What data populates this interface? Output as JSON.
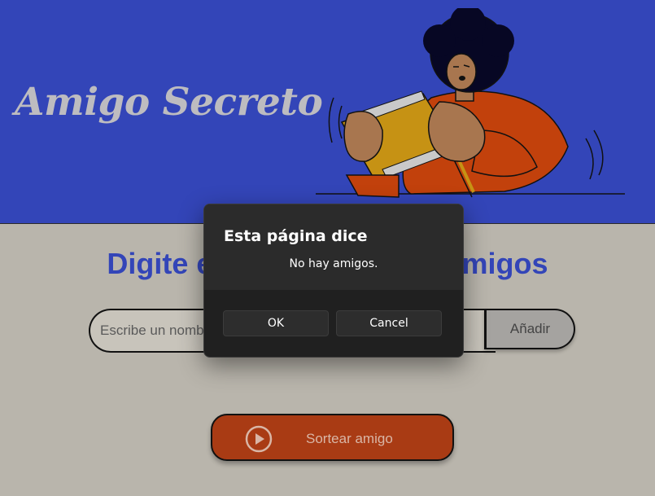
{
  "header": {
    "title": "Amigo Secreto",
    "illustration_icon": "person-holding-gift-box-illustration"
  },
  "main": {
    "section_title": "Digite el nombre de sus amigos",
    "name_input": {
      "placeholder": "Escribe un nombre",
      "value": ""
    },
    "add_button_label": "Añadir",
    "draw_button_label": "Sortear amigo",
    "draw_button_icon": "play-circle-icon"
  },
  "dialog": {
    "title": "Esta página dice",
    "message": "No hay amigos.",
    "ok_label": "OK",
    "cancel_label": "Cancel"
  },
  "colors": {
    "header_bg": "#3345b8",
    "page_bg": "#b9b5ac",
    "accent_title": "#3345b8",
    "draw_button_bg": "#a93b14",
    "dialog_bg": "#202020"
  }
}
